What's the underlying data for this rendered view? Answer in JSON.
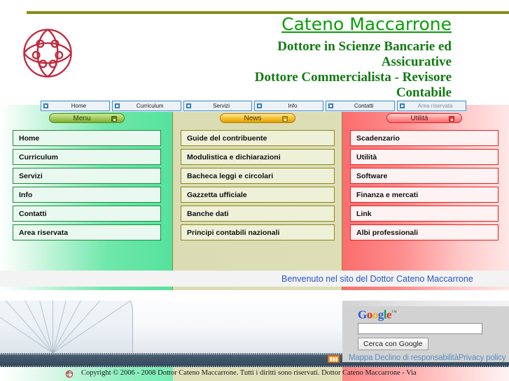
{
  "header": {
    "site_title": "Cateno Maccarrone",
    "subtitle_lines": [
      "Dottore in Scienze Bancarie ed",
      "Assicurative",
      "Dottore Commercialista - Revisore",
      "Contabile"
    ],
    "logo_name": "ornamental-circle-logo",
    "title_color": "#0a9e0a",
    "rule_color": "#8a8a1c"
  },
  "topnav": {
    "items": [
      {
        "label": "Home"
      },
      {
        "label": "Curriculum"
      },
      {
        "label": "Servizi"
      },
      {
        "label": "Info"
      },
      {
        "label": "Contatti"
      },
      {
        "label": "Area riservata"
      }
    ]
  },
  "columns": {
    "menu": {
      "heading": "Menu",
      "accent": "#7fae33",
      "items": [
        {
          "label": "Home"
        },
        {
          "label": "Curriculum"
        },
        {
          "label": "Servizi"
        },
        {
          "label": "Info"
        },
        {
          "label": "Contatti"
        },
        {
          "label": "Area riservata"
        }
      ]
    },
    "news": {
      "heading": "News",
      "accent": "#e0a300",
      "items": [
        {
          "label": "Guide del contribuente"
        },
        {
          "label": "Modulistica e dichiarazioni"
        },
        {
          "label": "Bacheca leggi e circolari"
        },
        {
          "label": "Gazzetta ufficiale"
        },
        {
          "label": "Banche dati"
        },
        {
          "label": "Principi contabili nazionali"
        }
      ]
    },
    "utilita": {
      "heading": "Utilità",
      "accent": "#ee3b3b",
      "items": [
        {
          "label": "Scadenzario"
        },
        {
          "label": "Utilità"
        },
        {
          "label": "Software"
        },
        {
          "label": "Finanza e mercati"
        },
        {
          "label": "Link"
        },
        {
          "label": "Albi professionali"
        }
      ]
    }
  },
  "marquee": {
    "text": "Benvenuto nel sito del Dottor Cateno Maccarrone",
    "color": "#2a55c8"
  },
  "search": {
    "brand_letters": [
      "G",
      "o",
      "o",
      "g",
      "l",
      "e"
    ],
    "trademark": "™",
    "value": "",
    "placeholder": "",
    "button_label": "Cerca con Google",
    "links": [
      "Mappa",
      "Declino di responsabilità",
      "Privacy policy"
    ]
  },
  "footer": {
    "copyright": "Copyright © 2006 - 2008 Dottor Cateno Maccarrone. Tutti i diritti sono riservati. Dottor Cateno Maccarrone - Via"
  }
}
